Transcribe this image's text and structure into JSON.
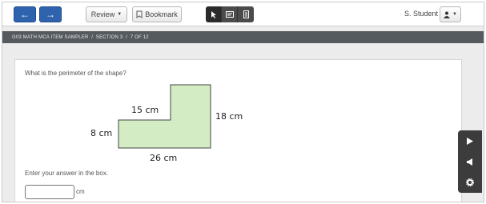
{
  "toolbar": {
    "back_icon": "←",
    "forward_icon": "→",
    "review_label": "Review",
    "bookmark_label": "Bookmark",
    "student_name": "S. Student",
    "accent": "#2f63ae"
  },
  "breadcrumb": {
    "text": "G03 MATH MCA ITEM SAMPLER  /  SECTION 3  /  7 OF 12"
  },
  "question": {
    "prompt": "What is the perimeter of the shape?",
    "labels": {
      "top": "15 cm",
      "right": "18 cm",
      "left": "8 cm",
      "bottom": "26 cm"
    },
    "shape_fill": "#d4ecc4",
    "answer_prompt": "Enter your answer in the box.",
    "answer_value": "",
    "unit": "cm"
  }
}
